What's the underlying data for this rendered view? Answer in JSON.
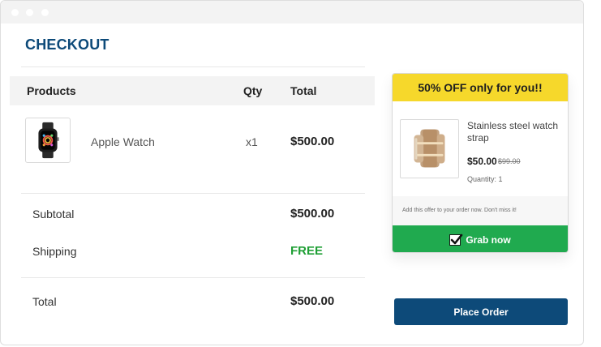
{
  "checkout": {
    "title": "CHECKOUT"
  },
  "table": {
    "headers": {
      "products": "Products",
      "qty": "Qty",
      "total": "Total"
    },
    "product": {
      "name": "Apple Watch",
      "qty": "x1",
      "total": "$500.00",
      "icon": "apple-watch-image"
    }
  },
  "summary": {
    "subtotal_label": "Subtotal",
    "subtotal_value": "$500.00",
    "shipping_label": "Shipping",
    "shipping_value": "FREE",
    "total_label": "Total",
    "total_value": "$500.00"
  },
  "offer": {
    "banner": "50% OFF only for you!!",
    "name": "Stainless steel watch strap",
    "price": "$50.00",
    "old_price": "$99.00",
    "quantity": "Quantity: 1",
    "note": "Add this offer to your order now. Don't miss it!",
    "button_label": "Grab now",
    "image": "watch-strap-image"
  },
  "actions": {
    "place_order": "Place Order"
  },
  "colors": {
    "brand_blue": "#0d4a79",
    "offer_yellow": "#f6d82b",
    "grab_green": "#20aa4f",
    "free_green": "#1f9f35"
  }
}
